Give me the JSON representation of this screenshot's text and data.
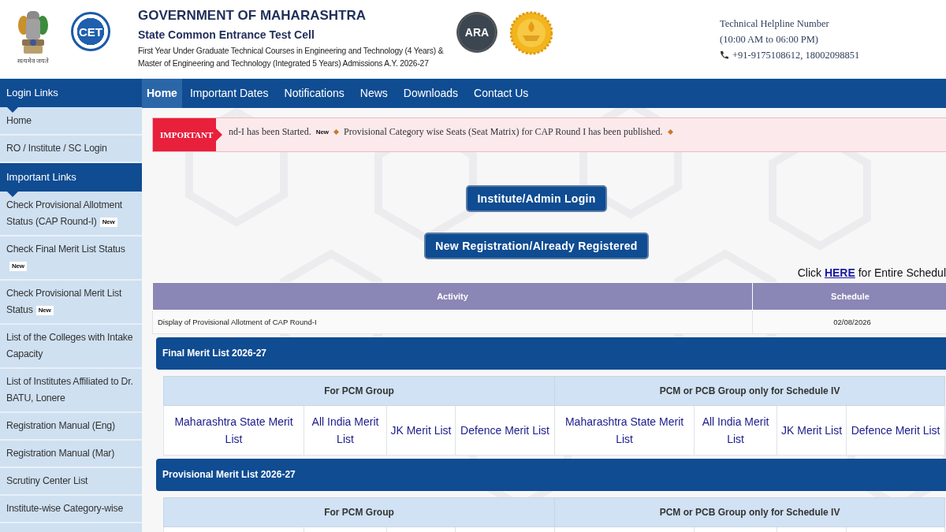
{
  "header": {
    "motto": "सत्यमेव जयते",
    "cet_logo": "CET",
    "title": "GOVERNMENT OF MAHARASHTRA",
    "subtitle": "State Common Entrance Test Cell",
    "description": [
      "First Year Under Graduate Technical Courses in Engineering and Technology (4 Years) &",
      "Master of Engineering and Technology (Integrated 5 Years) Admissions A.Y. 2026-27"
    ],
    "ara_logo": "ARA",
    "helpline": {
      "label": "Technical Helpline Number",
      "hours": "(10:00 AM to 06:00 PM)",
      "phones": "+91-9175108612, 18002098851"
    }
  },
  "nav": [
    {
      "label": "Home",
      "selected": true
    },
    {
      "label": "Important Dates",
      "selected": false
    },
    {
      "label": "Notifications",
      "selected": false
    },
    {
      "label": "News",
      "selected": false
    },
    {
      "label": "Downloads",
      "selected": false
    },
    {
      "label": "Contact Us",
      "selected": false
    }
  ],
  "sidebar": [
    {
      "kind": "header",
      "label": "Login Links"
    },
    {
      "kind": "link",
      "label": "Home"
    },
    {
      "kind": "link",
      "label": "RO / Institute / SC Login"
    },
    {
      "kind": "header",
      "label": "Important Links"
    },
    {
      "kind": "link",
      "label": "Check Provisional Allotment Status (CAP Round-I)",
      "badge": "New"
    },
    {
      "kind": "link",
      "label": "Check Final Merit List Status",
      "badge": "New"
    },
    {
      "kind": "link",
      "label": "Check Provisional Merit List Status",
      "badge": "New"
    },
    {
      "kind": "link",
      "label": "List of the Colleges with Intake Capacity"
    },
    {
      "kind": "link",
      "label": "List of Institutes Affiliated to Dr. BATU, Lonere"
    },
    {
      "kind": "link",
      "label": "Registration Manual (Eng)"
    },
    {
      "kind": "link",
      "label": "Registration Manual (Mar)"
    },
    {
      "kind": "link",
      "label": "Scrutiny Center List"
    },
    {
      "kind": "link",
      "label": "Institute-wise Category-wise"
    }
  ],
  "ticker": {
    "label": "IMPORTANT",
    "items": [
      {
        "text": "nd-I has been Started.",
        "badge": "New"
      },
      {
        "text": "Provisional Category wise Seats (Seat Matrix) for CAP Round I has been published."
      }
    ]
  },
  "buttons": [
    "Institute/Admin Login",
    "New Registration/Already Registered"
  ],
  "schedule_note": {
    "before": "Click",
    "link": "HERE",
    "after": "for Entire Schedul"
  },
  "schedule_table": {
    "columns": [
      "Activity",
      "Schedule"
    ],
    "rows": [
      [
        "Display of Provisional Allotment of CAP Round-I",
        "02/08/2026"
      ]
    ]
  },
  "merit_sections": [
    {
      "title": "Final Merit List 2026-27",
      "groups": [
        "For PCM Group",
        "PCM or PCB Group only for Schedule IV"
      ],
      "lists": [
        "Maharashtra State Merit List",
        "All India Merit List",
        "JK Merit List",
        "Defence Merit List",
        "Maharashtra State Merit List",
        "All India Merit List",
        "JK Merit List",
        "Defence Merit List"
      ]
    },
    {
      "title": "Provisional Merit List 2026-27",
      "groups": [
        "For PCM Group",
        "PCM or PCB Group only for Schedule IV"
      ]
    }
  ]
}
